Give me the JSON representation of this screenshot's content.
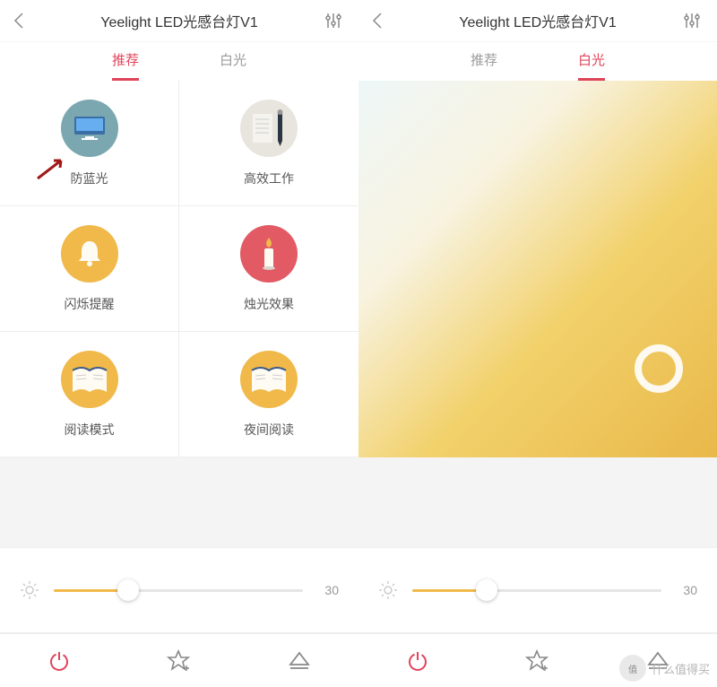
{
  "left": {
    "header": {
      "title": "Yeelight LED光感台灯V1"
    },
    "tabs": {
      "recommend": "推荐",
      "white": "白光",
      "active": "recommend"
    },
    "modes": [
      {
        "label": "防蓝光",
        "icon": "monitor-icon",
        "bg": "#7aa7b0"
      },
      {
        "label": "高效工作",
        "icon": "pen-note-icon",
        "bg": "#e8e5df"
      },
      {
        "label": "闪烁提醒",
        "icon": "bell-icon",
        "bg": "#f0b94a"
      },
      {
        "label": "烛光效果",
        "icon": "candle-icon",
        "bg": "#e25a64"
      },
      {
        "label": "阅读模式",
        "icon": "book-icon",
        "bg": "#f0b94a"
      },
      {
        "label": "夜间阅读",
        "icon": "book-icon",
        "bg": "#f0b94a"
      }
    ],
    "slider": {
      "value": "30",
      "percent": 30
    },
    "bottombar": {
      "power": "power-icon",
      "fav": "star-plus-icon",
      "eject": "eject-icon"
    }
  },
  "right": {
    "header": {
      "title": "Yeelight LED光感台灯V1"
    },
    "tabs": {
      "recommend": "推荐",
      "white": "白光",
      "active": "white"
    },
    "slider": {
      "value": "30",
      "percent": 30
    },
    "bottombar": {
      "power": "power-icon",
      "fav": "star-plus-icon",
      "eject": "eject-icon"
    }
  },
  "watermark": {
    "text": "什么值得买"
  }
}
